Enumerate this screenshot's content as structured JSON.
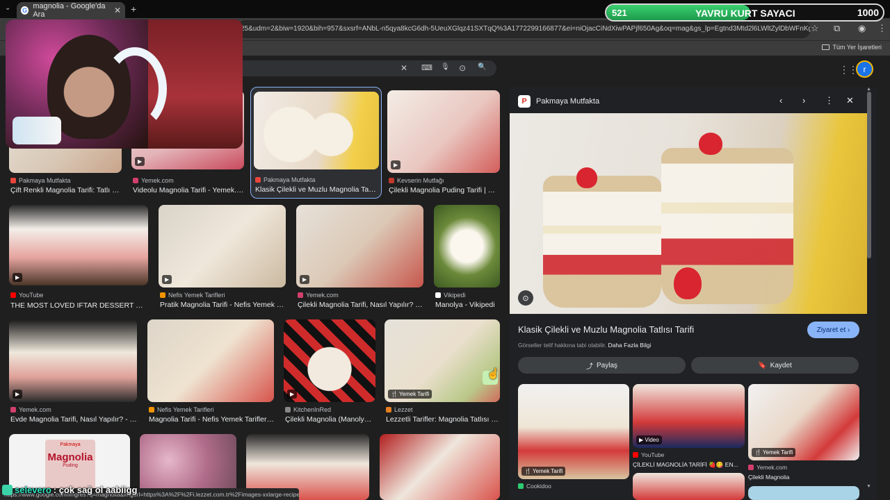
{
  "browser": {
    "tab_title": "magnolia - Google'da Ara",
    "tab_close": "✕",
    "new_tab": "+",
    "tab_menu": "⌄",
    "url": "25&udm=2&biw=1920&bih=957&sxsrf=ANbL-n5qya8kcG6dh-5UeuXGlqz41SXTqQ%3A1772299166877&ei=niOjacCiNdXiwPAPjf650Ag&oq=mag&gs_lp=Egtnd3Mtd2l6LWltZylDbWFnKgIIATIIEAA...",
    "bookmarks_all": "Tüm Yer İşaretleri",
    "status_url": "https://www.google.com/imgres?q=magnolia&imgurl=https%3A%2F%2Fi.lezzet.com.tr%2Fimages-xxlarge-recipe%2..."
  },
  "google": {
    "avatar_letter": "r",
    "icons": {
      "clear": "✕",
      "keyboard": "⌨",
      "mic": "🎙",
      "lens": "⊙",
      "search": "🔍",
      "apps": "⋮⋮⋮"
    }
  },
  "results": [
    {
      "source": "Pakmaya Mutfakta",
      "title": "Çift Renkli Magnolia Tarifi: Tatlı Se...",
      "src_color": "#e8453c"
    },
    {
      "source": "Yemek.com",
      "title": "Videolu Magnolia Tarifi - Yemek.com",
      "src_color": "#d23f6c"
    },
    {
      "source": "Pakmaya Mutfakta",
      "title": "Klasik Çilekli ve Muzlu Magnolia Tatlıs...",
      "src_color": "#e8453c"
    },
    {
      "source": "Kevserin Mutfağı",
      "title": "Çilekli Magnolia Puding Tarifi | Ke...",
      "src_color": "#c0392b"
    },
    {
      "source": "YouTube",
      "title": "THE MOST LOVED IFTAR DESSERT 🍹 S...",
      "src_color": "#ff0000"
    },
    {
      "source": "Nefis Yemek Tarifleri",
      "title": "Pratik Magnolia Tarifi - Nefis Yemek Tari...",
      "src_color": "#f29400"
    },
    {
      "source": "Yemek.com",
      "title": "Çilekli Magnolia Tarifi, Nasıl Yapılır? (R...",
      "src_color": "#d23f6c"
    },
    {
      "source": "Vikipedi",
      "title": "Manolya - Vikipedi",
      "src_color": "#ffffff"
    },
    {
      "source": "Yemek.com",
      "title": "Evde Magnolia Tarifi, Nasıl Yapılır? - Ye...",
      "src_color": "#d23f6c"
    },
    {
      "source": "Nefis Yemek Tarifleri",
      "title": "Magnolia Tarifi - Nefis Yemek Tarifleri - ...",
      "src_color": "#f29400"
    },
    {
      "source": "KitchenInRed",
      "title": "Çilekli Magnolia (Manolya) ...",
      "src_color": "#888888"
    },
    {
      "source": "Lezzet",
      "title": "Lezzetli Tarifler: Magnolia Tatlısı N...",
      "src_color": "#e67e22"
    }
  ],
  "thumb_badges": {
    "video": "▶",
    "recipe": "🍴 Yemek Tarifi"
  },
  "bottom_thumb": {
    "brand": "Pakmaya",
    "title": "Magnolia",
    "sub": "Puding"
  },
  "panel": {
    "source": "Pakmaya Mutfakta",
    "title": "Klasik Çilekli ve Muzlu Magnolia Tatlısı Tarifi",
    "note": "Görseller telif hakkına tabi olabilir.",
    "note_link": "Daha Fazla Bilgi",
    "visit": "Ziyaret et ›",
    "share": "Paylaş",
    "save": "Kaydet",
    "nav": {
      "prev": "‹",
      "next": "›",
      "more": "⋮",
      "close": "✕"
    },
    "related": [
      {
        "badge": "🍴 Yemek Tarifi",
        "source": "Cookidoo",
        "title": ""
      },
      {
        "badge": "▶ Video",
        "source": "YouTube",
        "title": "ÇİLEKLİ MAGNOLİA TARİFİ 🍓😋 EN..."
      },
      {
        "badge": "🍴 Yemek Tarifi",
        "source": "Yemek.com",
        "title": "Çilekli Magnolia"
      }
    ]
  },
  "counter": {
    "current": "521",
    "label": "YAVRU KURT SAYACI",
    "max": "1000",
    "progress": 0.521
  },
  "chat": {
    "user": "selevero",
    "message": ": çok sağ ol aabiigg"
  }
}
